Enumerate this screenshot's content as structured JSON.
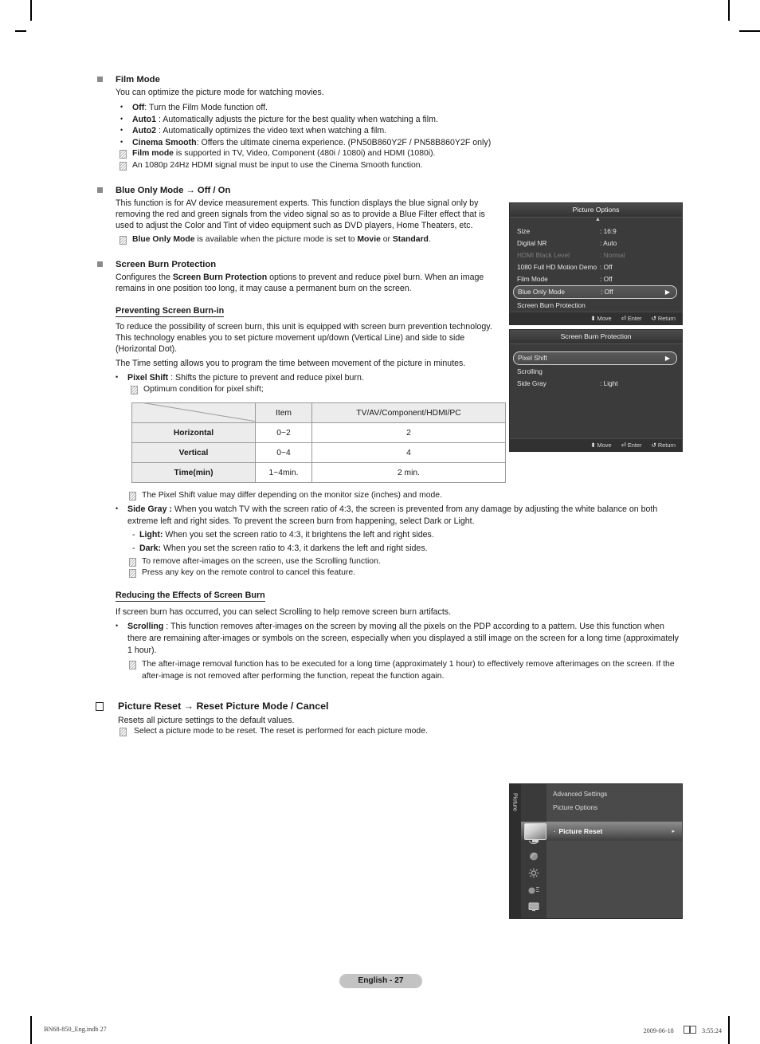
{
  "page": {
    "badge": "English - 27",
    "footer_left": "BN68-850_Eng.indb   27",
    "footer_right_date": "2009-06-18",
    "footer_right_time": "3:55:24"
  },
  "sections": {
    "film_mode": {
      "heading": "Film Mode",
      "intro": "You can optimize the picture mode for watching movies.",
      "bullets": [
        {
          "term": "Off",
          "rest": ": Turn the Film Mode function off."
        },
        {
          "term": "Auto1",
          "rest": " : Automatically adjusts the picture for the best quality when watching a film."
        },
        {
          "term": "Auto2",
          "rest": " : Automatically optimizes the video text when watching a film."
        },
        {
          "term": "Cinema Smooth",
          "rest": ": Offers the ultimate cinema experience. (PN50B860Y2F / PN58B860Y2F only)"
        }
      ],
      "notes": [
        {
          "term": "Film mode",
          "rest": " is supported in TV, Video, Component (480i / 1080i)  and HDMI (1080i)."
        },
        {
          "term": "",
          "rest": "An 1080p 24Hz HDMI signal must be input to use the Cinema Smooth function."
        }
      ]
    },
    "blue_only_mode": {
      "heading": "Blue Only Mode → Off / On",
      "body": "This function is for AV device measurement experts. This function displays the blue signal only by removing the red and green signals from the video signal so as to provide a Blue Filter effect that is used to adjust the Color and Tint of video equipment such as DVD players, Home Theaters, etc.",
      "note_pre": "Blue Only Mode",
      "note_mid": " is available when the picture mode is set to ",
      "note_bold1": "Movie",
      "note_or": " or ",
      "note_bold2": "Standard",
      "note_end": "."
    },
    "screen_burn": {
      "heading": "Screen Burn Protection",
      "body_pre": "Configures the ",
      "body_bold": "Screen Burn Protection",
      "body_post": " options to prevent and reduce pixel burn. When an image remains in one position too long, it may cause a permanent burn on the screen.",
      "subhead_prevent": "Preventing Screen Burn-in",
      "prevent_p1": "To reduce the possibility of screen burn, this unit is equipped with screen burn prevention technology. This technology enables you to set picture movement up/down (Vertical Line) and side to side (Horizontal Dot).",
      "prevent_p2": "The Time setting allows you to program the time between movement of the picture in minutes.",
      "pixel_shift_term": "Pixel Shift",
      "pixel_shift_rest": " : Shifts the picture to prevent and reduce pixel burn.",
      "pixel_shift_note": "Optimum condition for pixel shift;",
      "table_note": "The Pixel Shift value may differ depending on the monitor size (inches) and mode.",
      "side_gray_term": "Side Gray :",
      "side_gray_rest": " When you watch TV with the screen ratio of 4:3, the screen is prevented from any damage by adjusting the white balance on both extreme left and right sides. To prevent the screen burn from happening, select Dark or Light.",
      "light_term": "Light:",
      "light_rest": " When you set the screen ratio to 4:3, it brightens the left and right sides.",
      "dark_term": "Dark:",
      "dark_rest": " When you set the screen ratio to 4:3, it darkens the left and right sides.",
      "note_scrolling": "To remove after-images on the screen, use the Scrolling function.",
      "note_cancel": "Press any key on the remote control to cancel this feature.",
      "subhead_reducing": "Reducing the Effects of Screen Burn",
      "reducing_p1": "If screen burn has occurred, you can select Scrolling to help remove screen burn artifacts.",
      "scrolling_term": "Scrolling",
      "scrolling_rest": " : This function removes after-images on the screen by moving all the pixels on the PDP according to a pattern. Use this function when there are remaining after-images or symbols on the screen, especially when you displayed a still image on the screen for a long time (approximately 1 hour).",
      "scrolling_note": "The after-image removal function has to be executed for a long time (approximately 1 hour) to effectively remove afterimages on the screen. If the after-image is not removed after performing the function, repeat the function again."
    },
    "picture_reset": {
      "heading": "Picture Reset → Reset Picture Mode / Cancel",
      "body": "Resets all picture settings to the default values.",
      "note": "Select a picture mode to be reset. The reset is performed for each picture mode."
    }
  },
  "pixel_shift_table": {
    "header": [
      "",
      "Item",
      "TV/AV/Component/HDMI/PC"
    ],
    "rows": [
      {
        "label": "Horizontal",
        "item": "0~2",
        "mode": "2"
      },
      {
        "label": "Vertical",
        "item": "0~4",
        "mode": "4"
      },
      {
        "label": "Time(min)",
        "item": "1~4min.",
        "mode": "2 min."
      }
    ]
  },
  "osd_picture_options": {
    "title": "Picture Options",
    "rows": [
      {
        "label": "Size",
        "value": ": 16:9",
        "state": "normal"
      },
      {
        "label": "Digital NR",
        "value": ": Auto",
        "state": "normal"
      },
      {
        "label": "HDMI Black Level",
        "value": ": Normal",
        "state": "dim"
      },
      {
        "label": "1080 Full HD Motion Demo",
        "value": ": Off",
        "state": "normal"
      },
      {
        "label": "Film Mode",
        "value": ": Off",
        "state": "normal"
      },
      {
        "label": "Blue Only Mode",
        "value": ": Off",
        "state": "selected"
      },
      {
        "label": "Screen Burn Protection",
        "value": "",
        "state": "normal"
      }
    ],
    "footer": {
      "move": "Move",
      "enter": "Enter",
      "return": "Return"
    }
  },
  "osd_screen_burn": {
    "title": "Screen Burn Protection",
    "rows": [
      {
        "label": "Pixel Shift",
        "value": "",
        "state": "selected"
      },
      {
        "label": "Scrolling",
        "value": "",
        "state": "normal"
      },
      {
        "label": "Side Gray",
        "value": ": Light",
        "state": "normal"
      }
    ],
    "footer": {
      "move": "Move",
      "enter": "Enter",
      "return": "Return"
    }
  },
  "osd_picture_reset": {
    "side_label": "Picture",
    "items": [
      "Advanced Settings",
      "Picture Options"
    ],
    "selected": "Picture Reset"
  }
}
